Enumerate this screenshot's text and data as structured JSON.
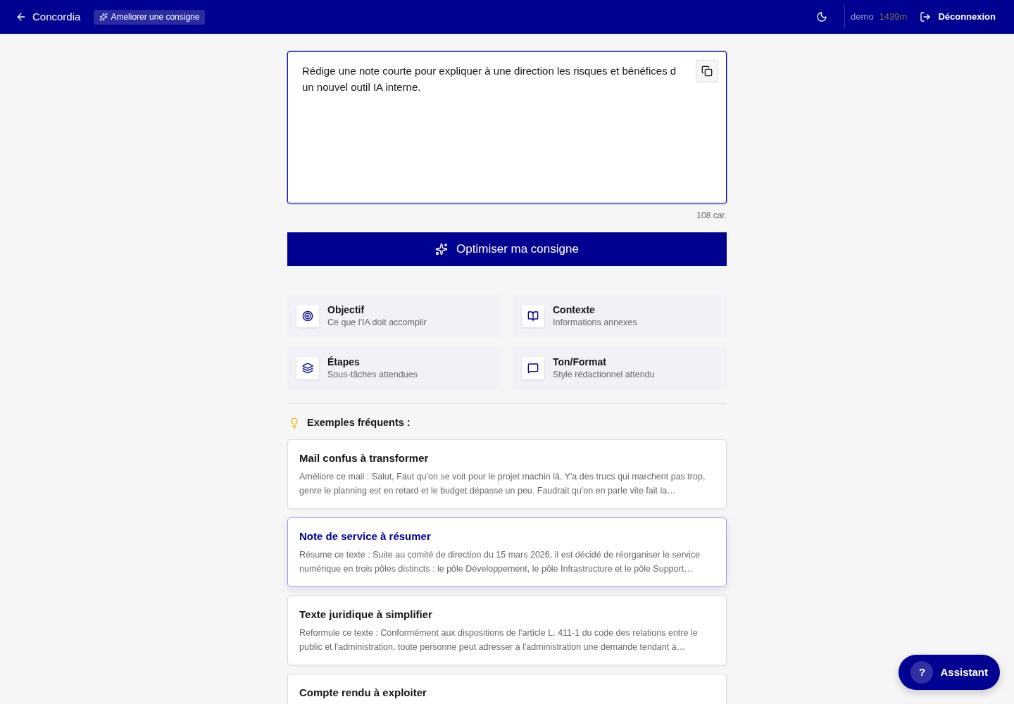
{
  "header": {
    "back_label": "Concordia",
    "badge": "Ameliorer une consigne",
    "user": "demo",
    "session_time": "1439m",
    "logout": "Déconnexion"
  },
  "prompt": {
    "value": "Rédige une note courte pour expliquer à une direction les risques et bénéfices d un nouvel outil IA interne.",
    "char_count": "108 car."
  },
  "optimize_button": "Optimiser ma consigne",
  "sections": [
    {
      "title": "Objectif",
      "subtitle": "Ce que l'IA doit accomplir"
    },
    {
      "title": "Contexte",
      "subtitle": "Informations annexes"
    },
    {
      "title": "Étapes",
      "subtitle": "Sous-tâches attendues"
    },
    {
      "title": "Ton/Format",
      "subtitle": "Style rédactionnel attendu"
    }
  ],
  "examples_heading": "Exemples fréquents :",
  "examples": [
    {
      "title": "Mail confus à transformer",
      "description": "Améliore ce mail : Salut, Faut qu'on se voit pour le projet machin là. Y'a des trucs qui marchent pas trop, genre le planning est en retard et le budget dépasse un peu. Faudrait qu'on en parle vite fait la…",
      "selected": false
    },
    {
      "title": "Note de service à résumer",
      "description": "Résume ce texte : Suite au comité de direction du 15 mars 2026, il est décidé de réorganiser le service numérique en trois pôles distincts : le pôle Développement, le pôle Infrastructure et le pôle Support…",
      "selected": true
    },
    {
      "title": "Texte juridique à simplifier",
      "description": "Reformule ce texte : Conformément aux dispositions de l'article L. 411-1 du code des relations entre le public et l'administration, toute personne peut adresser à l'administration une demande tendant à…",
      "selected": false
    },
    {
      "title": "Compte rendu à exploiter",
      "selected": false
    }
  ],
  "assistant_button": {
    "icon_text": "?",
    "label": "Assistant"
  }
}
